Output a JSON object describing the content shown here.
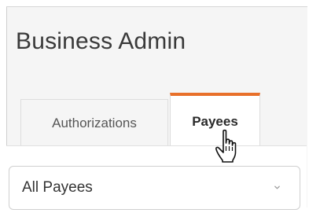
{
  "app": {
    "title": "Business Admin"
  },
  "tabs": [
    {
      "label": "Authorizations",
      "active": false
    },
    {
      "label": "Payees",
      "active": true
    }
  ],
  "payee_filter": {
    "selected": "All Payees"
  },
  "colors": {
    "active_tab_accent": "#e8702a"
  },
  "icons": {
    "chevron": "chevron-down-icon",
    "cursor": "hand-pointer-cursor-icon"
  }
}
